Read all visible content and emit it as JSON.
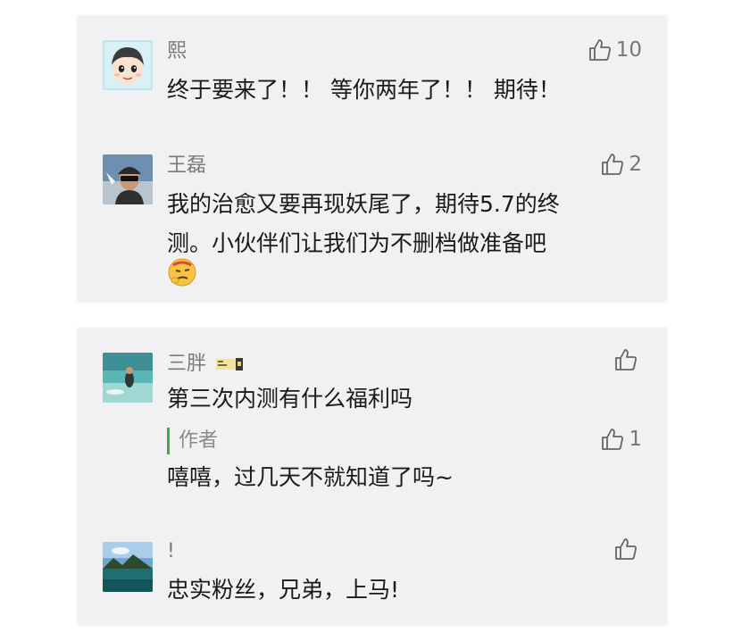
{
  "comments_card1": [
    {
      "name": "熙",
      "lines": [
        "终于要来了！！ 等你两年了！！ 期待！"
      ],
      "likes": "10",
      "avatar_icon": "cartoon-boy-avatar"
    },
    {
      "name": "王磊",
      "lines": [
        "我的治愈又要再现妖尾了，期待5.7的终",
        "测。小伙伴们让我们为不删档做准备吧"
      ],
      "likes": "2",
      "avatar_icon": "photo-avatar-man-sunglasses",
      "emoji_icon": "thinking-face-emoji"
    }
  ],
  "comments_card2": [
    {
      "name": "三胖",
      "lines": [
        "第三次内测有什么福利吗"
      ],
      "likes": "",
      "avatar_icon": "photo-avatar-underwater",
      "badge_icon": "level-badge-icon",
      "reply": {
        "author_label": "作者",
        "text": "嘻嘻，过几天不就知道了吗~",
        "likes": "1"
      }
    },
    {
      "name": "!",
      "lines": [
        "忠实粉丝，兄弟，上马!"
      ],
      "likes": "",
      "avatar_icon": "photo-avatar-lake-landscape"
    }
  ],
  "colors": {
    "card_bg": "#f1f1f3",
    "name_text": "#7a7a7a",
    "body_text": "#1a1a1a",
    "author_bar": "#3fae3f"
  }
}
